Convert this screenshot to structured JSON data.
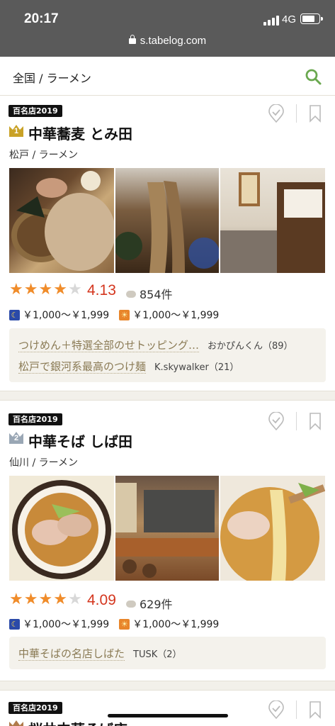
{
  "status": {
    "time": "20:17",
    "network": "4G",
    "url": "s.tabelog.com"
  },
  "header": {
    "breadcrumb": "全国 / ラーメン"
  },
  "restaurants": [
    {
      "badge": "百名店2019",
      "rank": "1",
      "name": "中華蕎麦 とみ田",
      "area": "松戸 / ラーメン",
      "stars_filled": 4,
      "rating": "4.13",
      "reviews": "854件",
      "dinner_price": "￥1,000～￥1,999",
      "lunch_price": "￥1,000～￥1,999",
      "review_snippets": [
        {
          "text": "つけめん＋特選全部のせトッピング…",
          "user": "おかぴんくん（89）"
        },
        {
          "text": "松戸で銀河系最高のつけ麺",
          "user": "K.skywalker（21）"
        }
      ]
    },
    {
      "badge": "百名店2019",
      "rank": "2",
      "name": "中華そば しば田",
      "area": "仙川 / ラーメン",
      "stars_filled": 4,
      "rating": "4.09",
      "reviews": "629件",
      "dinner_price": "￥1,000～￥1,999",
      "lunch_price": "￥1,000～￥1,999",
      "review_snippets": [
        {
          "text": "中華そばの名店しばた",
          "user": "TUSK（2）"
        }
      ]
    },
    {
      "badge": "百名店2019",
      "name": "桜井中華そば店"
    }
  ],
  "colors": {
    "star": "#f08c2a",
    "rating": "#d4361e",
    "gold_rank": "#c9a227",
    "silver_rank": "#9aa7b5",
    "search": "#6aa84f"
  }
}
